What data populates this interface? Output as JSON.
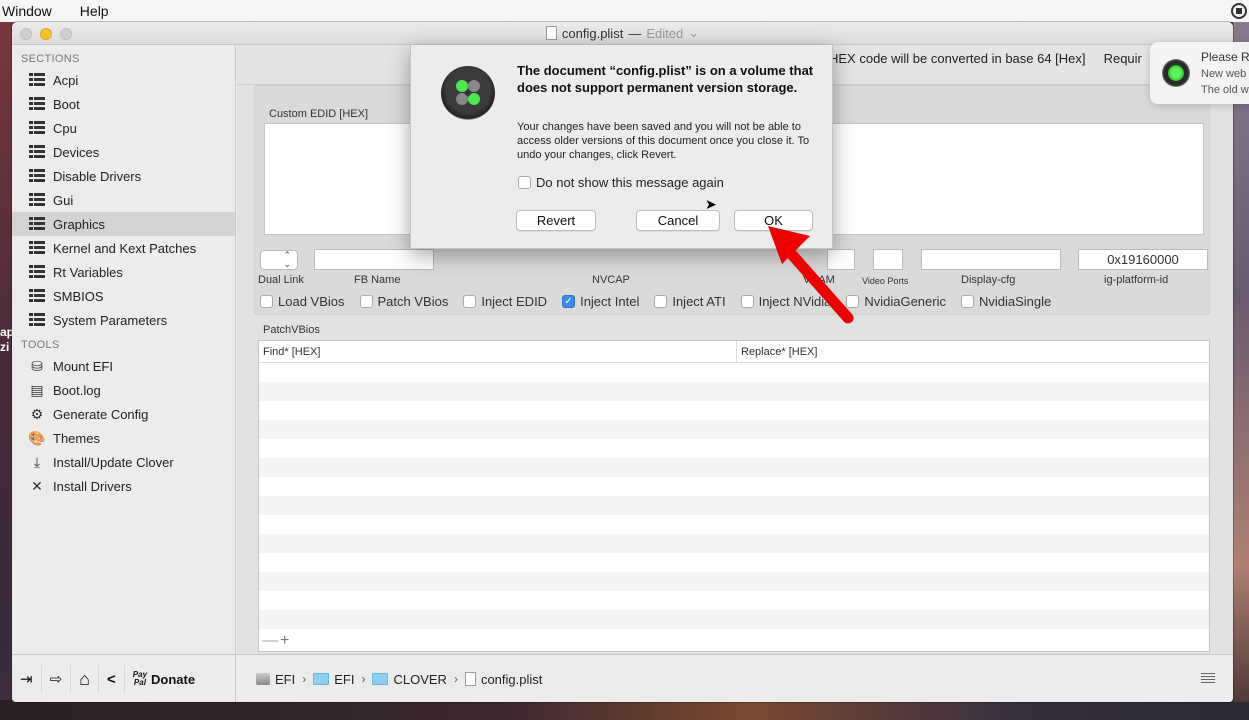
{
  "menubar": {
    "items": [
      "Window",
      "Help"
    ],
    "right_icon": "record-icon"
  },
  "desktop": {
    "left_text": [
      "ap",
      "zi"
    ]
  },
  "window": {
    "title": "config.plist",
    "title_sep": "—",
    "title_status": "Edited",
    "title_chevron": "⌄"
  },
  "sidebar": {
    "sections_header": "SECTIONS",
    "sections": [
      {
        "label": "Acpi",
        "icon": "list-icon"
      },
      {
        "label": "Boot",
        "icon": "list-icon"
      },
      {
        "label": "Cpu",
        "icon": "list-icon"
      },
      {
        "label": "Devices",
        "icon": "list-icon"
      },
      {
        "label": "Disable Drivers",
        "icon": "list-icon"
      },
      {
        "label": "Gui",
        "icon": "list-icon"
      },
      {
        "label": "Graphics",
        "icon": "list-icon",
        "selected": true
      },
      {
        "label": "Kernel and Kext Patches",
        "icon": "list-icon"
      },
      {
        "label": "Rt Variables",
        "icon": "list-icon"
      },
      {
        "label": "SMBIOS",
        "icon": "list-icon"
      },
      {
        "label": "System Parameters",
        "icon": "list-icon"
      }
    ],
    "tools_header": "TOOLS",
    "tools": [
      {
        "label": "Mount EFI",
        "icon": "disk-icon",
        "glyph": "⛁"
      },
      {
        "label": "Boot.log",
        "icon": "log-icon",
        "glyph": "▤"
      },
      {
        "label": "Generate Config",
        "icon": "gears-icon",
        "glyph": "⚙"
      },
      {
        "label": "Themes",
        "icon": "palette-icon",
        "glyph": "🎨"
      },
      {
        "label": "Install/Update Clover",
        "icon": "download-icon",
        "glyph": "⤓"
      },
      {
        "label": "Install Drivers",
        "icon": "tools-icon",
        "glyph": "✕"
      }
    ]
  },
  "bottombar": {
    "buttons": [
      {
        "name": "import-icon",
        "glyph": "⇥"
      },
      {
        "name": "export-icon",
        "glyph": "⇨"
      },
      {
        "name": "home-icon",
        "glyph": "⌂"
      },
      {
        "name": "share-icon",
        "glyph": "<"
      }
    ],
    "paypal_top": "Pay",
    "paypal_bottom": "Pal",
    "donate_label": "Donate",
    "breadcrumb": [
      "EFI",
      "EFI",
      "CLOVER",
      "config.plist"
    ],
    "breadcrumb_sep": "›"
  },
  "main": {
    "hex_note": "HEX code will be converted in base 64 [Hex]     Requir",
    "edid_label": "Custom EDID [HEX]",
    "edid_value": "",
    "stepper_glyph": "⌃⌄",
    "fields": {
      "dual_link_label": "Dual Link",
      "fb_name_label": "FB Name",
      "fb_name_value": "",
      "nvcap_label": "NVCAP",
      "vram_label": "VRAM",
      "vram_value": "",
      "video_ports_label": "Video Ports",
      "video_ports_value": "",
      "display_cfg_label": "Display-cfg",
      "display_cfg_value": "",
      "ig_platform_label": "ig-platform-id",
      "ig_platform_value": "0x19160000"
    },
    "checkboxes": [
      {
        "label": "Load VBios",
        "checked": false
      },
      {
        "label": "Patch VBios",
        "checked": false
      },
      {
        "label": "Inject EDID",
        "checked": false
      },
      {
        "label": "Inject Intel",
        "checked": true
      },
      {
        "label": "Inject ATI",
        "checked": false
      },
      {
        "label": "Inject NVidia",
        "checked": false
      },
      {
        "label": "NvidiaGeneric",
        "checked": false
      },
      {
        "label": "NvidiaSingle",
        "checked": false
      }
    ],
    "patch_vbios_label": "PatchVBios",
    "table_columns": [
      "Find* [HEX]",
      "Replace* [HEX]"
    ],
    "table_rows": [],
    "remove_label": "—",
    "add_label": "+"
  },
  "dialog": {
    "title": "The document “config.plist” is on a volume that does not support permanent version storage.",
    "body": "Your changes have been saved and you will not be able to access older versions of this document once you close it. To undo your changes, click Revert.",
    "checkbox_label": "Do not show this message again",
    "checkbox_checked": false,
    "revert_label": "Revert",
    "cancel_label": "Cancel",
    "ok_label": "OK"
  },
  "notification": {
    "title": "Please R",
    "line1": "New web",
    "line2": "The old w"
  },
  "colors": {
    "accent_blue": "#3b8ae6",
    "selection_gray": "#d3d3d3",
    "arrow_red": "#ee0000",
    "clover_green": "#4de84d"
  }
}
